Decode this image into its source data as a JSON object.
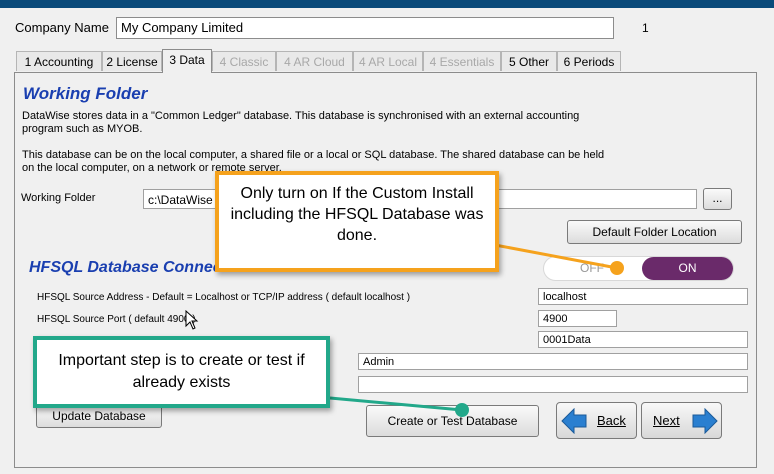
{
  "header": {
    "company_label": "Company Name",
    "company_value": "My Company Limited",
    "company_number": "1"
  },
  "tabs": [
    {
      "label": "1 Accounting",
      "state": "normal"
    },
    {
      "label": "2 License",
      "state": "normal"
    },
    {
      "label": "3 Data",
      "state": "active"
    },
    {
      "label": "4 Classic",
      "state": "disabled"
    },
    {
      "label": "4 AR Cloud",
      "state": "disabled"
    },
    {
      "label": "4 AR Local",
      "state": "disabled"
    },
    {
      "label": "4 Essentials",
      "state": "disabled"
    },
    {
      "label": "5 Other",
      "state": "normal"
    },
    {
      "label": "6 Periods",
      "state": "normal"
    }
  ],
  "working_folder": {
    "title": "Working Folder",
    "para1_line1": "DataWise stores data in a  \"Common Ledger\"  database.  This database is synchronised with an external accounting",
    "para1_line2": "program such as MYOB.",
    "para2_line1": "This database can be on the local computer, a shared file or a local or SQL database. The shared database can be held",
    "para2_line2": "on the local computer, on a network or remote server.",
    "folder_label": "Working Folder",
    "folder_value": "c:\\DataWise",
    "browse_label": "...",
    "default_button": "Default Folder Location"
  },
  "hfsql": {
    "title": "HFSQL Database Connection",
    "toggle_off": "OFF",
    "toggle_on": "ON",
    "source_address_label": "HFSQL Source Address - Default = Localhost or TCP/IP address ( default  localhost )",
    "source_address_value": "localhost",
    "source_port_label": "HFSQL Source Port ( default 4900 )",
    "source_port_value": "4900",
    "database_value": "0001Data",
    "user_value": "Admin",
    "password_value": "",
    "update_button": "Update Database",
    "create_button": "Create or Test Database"
  },
  "nav": {
    "back": "Back",
    "next": "Next"
  },
  "callouts": {
    "orange": "Only turn on If the Custom Install including the HFSQL Database was done.",
    "green": "Important step is to create  or test if already exists"
  },
  "colors": {
    "title_blue": "#1a3fb0",
    "toggle_on": "#6a2a6a",
    "callout_orange": "#f5a21d",
    "callout_green": "#22a88a",
    "arrow_blue": "#2a7fd0"
  }
}
